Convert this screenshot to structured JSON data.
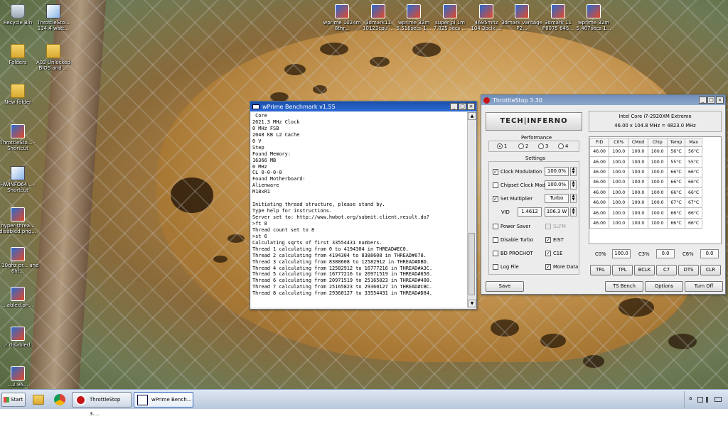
{
  "desktop_icons": [
    {
      "label": "Recycle Bin",
      "icon": "recycle-bin-icon"
    },
    {
      "label": "ThrottleSto... 134.4 watt...",
      "icon": "image-file-icon"
    },
    {
      "label": "Folders",
      "icon": "folder-icon"
    },
    {
      "label": "A03 Unlocked BIOS and ...",
      "icon": "folder-icon"
    },
    {
      "label": "New folder",
      "icon": "folder-icon"
    },
    {
      "label": "ThrottleSto... - Shortcut",
      "icon": "throttlestop-icon"
    },
    {
      "label": "HWINFO64... - Shortcut",
      "icon": "hwinfo-icon"
    },
    {
      "label": "hyper-threa... disabled.png...",
      "icon": "image-file-icon"
    },
    {
      "label": "3.10ghz pr... and 6ht...",
      "icon": "image-file-icon"
    },
    {
      "label": "...abled.pn...",
      "icon": "image-file-icon"
    },
    {
      "label": "...r disabled...",
      "icon": "image-file-icon"
    },
    {
      "label": "...2.96...",
      "icon": "image-file-icon"
    },
    {
      "label": "wprime 1024m 8thr...",
      "icon": "image-file-icon"
    },
    {
      "label": "3dmark11 10123cpu ...",
      "icon": "image-file-icon"
    },
    {
      "label": "wprime 32m 5.516secs 1...",
      "icon": "image-file-icon"
    },
    {
      "label": "super pi 1m 7.825 secs ...",
      "icon": "image-file-icon"
    },
    {
      "label": "4695mhz 104.3bclk ...",
      "icon": "image-file-icon"
    },
    {
      "label": "3dmark vantage P2...",
      "icon": "image-file-icon"
    },
    {
      "label": "3dmark 11 P8075 645...",
      "icon": "image-file-icon"
    },
    {
      "label": "wprime 32m 5.407secs 1...",
      "icon": "image-file-icon"
    }
  ],
  "wprime": {
    "title": "wPrime Benchmark v1.55",
    "lines": [
      " Core",
      "2621.3 MHz Clock",
      "0 MHz FSB",
      "2048 KB L2 Cache",
      "0 V",
      "Step",
      "Found Memory:",
      "16366 MB",
      "0 MHz",
      "CL 0-0-0-0",
      "Found Motherboard:",
      "Alienware",
      "M18xR1",
      "",
      "Initiating thread structure, please stand by.",
      "Type help for instructions.",
      "Server set to: http://www.hwbot.org/submit.client.result.do?",
      ">ft 8",
      "Thread count set to 8",
      ">st 6",
      "Calculating sqrts of first 33554431 numbers.",
      "Thread 1 calculating from 0 to 4194304 in THREAD#EC0.",
      "Thread 2 calculating from 4194304 to 8388608 in THREAD#678.",
      "Thread 3 calculating from 8388608 to 12582912 in THREAD#DBD.",
      "Thread 4 calculating from 12582912 to 16777216 in THREAD#A3C.",
      "Thread 5 calculating from 16777216 to 20971519 in THREAD#650.",
      "Thread 6 calculating from 20971519 to 25165823 in THREAD#408.",
      "Thread 7 calculating from 25165823 to 29360127 in THREAD#CBC.",
      "Thread 8 calculating from 29360127 to 33554431 in THREAD#D84."
    ]
  },
  "throttlestop": {
    "title": "ThrottleStop 3.30",
    "logo": "TECH|INFERNO",
    "cpu_name": "Intel Core i7-2920XM Extreme",
    "cpu_freq": "46.00 x 104.8 MHz = 4823.0 MHz",
    "performance_label": "Performance",
    "radios": [
      "1",
      "2",
      "3",
      "4"
    ],
    "settings_label": "Settings",
    "clock_modulation": {
      "label": "Clock Modulation",
      "value": "100.0%",
      "checked": "✓"
    },
    "chipset_clock_mod": {
      "label": "Chipset Clock Mod",
      "value": "100.0%"
    },
    "set_multiplier": {
      "label": "Set Multiplier",
      "value": "Turbo",
      "checked": "✓"
    },
    "vid": {
      "label": "VID",
      "value": "1.4612",
      "watts": "106.3 W"
    },
    "power_saver": "Power Saver",
    "slfm": "SLFM",
    "disable_turbo": "Disable Turbo",
    "eist": {
      "label": "EIST",
      "checked": "✓"
    },
    "bd_prochot": "BD PROCHOT",
    "c1e": {
      "label": "C1E",
      "checked": "✓"
    },
    "log_file": "Log File",
    "more_data": {
      "label": "More Data",
      "checked": "✓"
    },
    "table_headers": [
      "FID",
      "C0%",
      "CMod",
      "Chip",
      "Temp",
      "Max"
    ],
    "table_rows": [
      [
        "46.00",
        "100.0",
        "100.0",
        "100.0",
        "56°C",
        "56°C"
      ],
      [
        "46.00",
        "100.0",
        "100.0",
        "100.0",
        "55°C",
        "55°C"
      ],
      [
        "46.00",
        "100.0",
        "100.0",
        "100.0",
        "66°C",
        "66°C"
      ],
      [
        "46.00",
        "100.0",
        "100.0",
        "100.0",
        "66°C",
        "66°C"
      ],
      [
        "46.00",
        "100.0",
        "100.0",
        "100.0",
        "66°C",
        "66°C"
      ],
      [
        "46.00",
        "100.0",
        "100.0",
        "100.0",
        "67°C",
        "67°C"
      ],
      [
        "46.00",
        "100.0",
        "100.0",
        "100.0",
        "66°C",
        "66°C"
      ],
      [
        "46.00",
        "100.0",
        "100.0",
        "100.0",
        "66°C",
        "66°C"
      ]
    ],
    "c0_label": "C0%",
    "c0_value": "100.0",
    "c3_label": "C3%",
    "c3_value": "0.0",
    "c6_label": "C6%",
    "c6_value": "0.0",
    "buttons_row1": [
      "TRL",
      "TPL",
      "BCLK",
      "C7",
      "DTS",
      "CLR"
    ],
    "save": "Save",
    "ts_bench": "TS Bench",
    "options": "Options",
    "turn_off": "Turn Off"
  },
  "taskbar": {
    "start": "Start",
    "items": [
      {
        "label": "ThrottleStop 3...."
      },
      {
        "label": "wPrime Bench..."
      }
    ],
    "tray_letter": "a"
  }
}
